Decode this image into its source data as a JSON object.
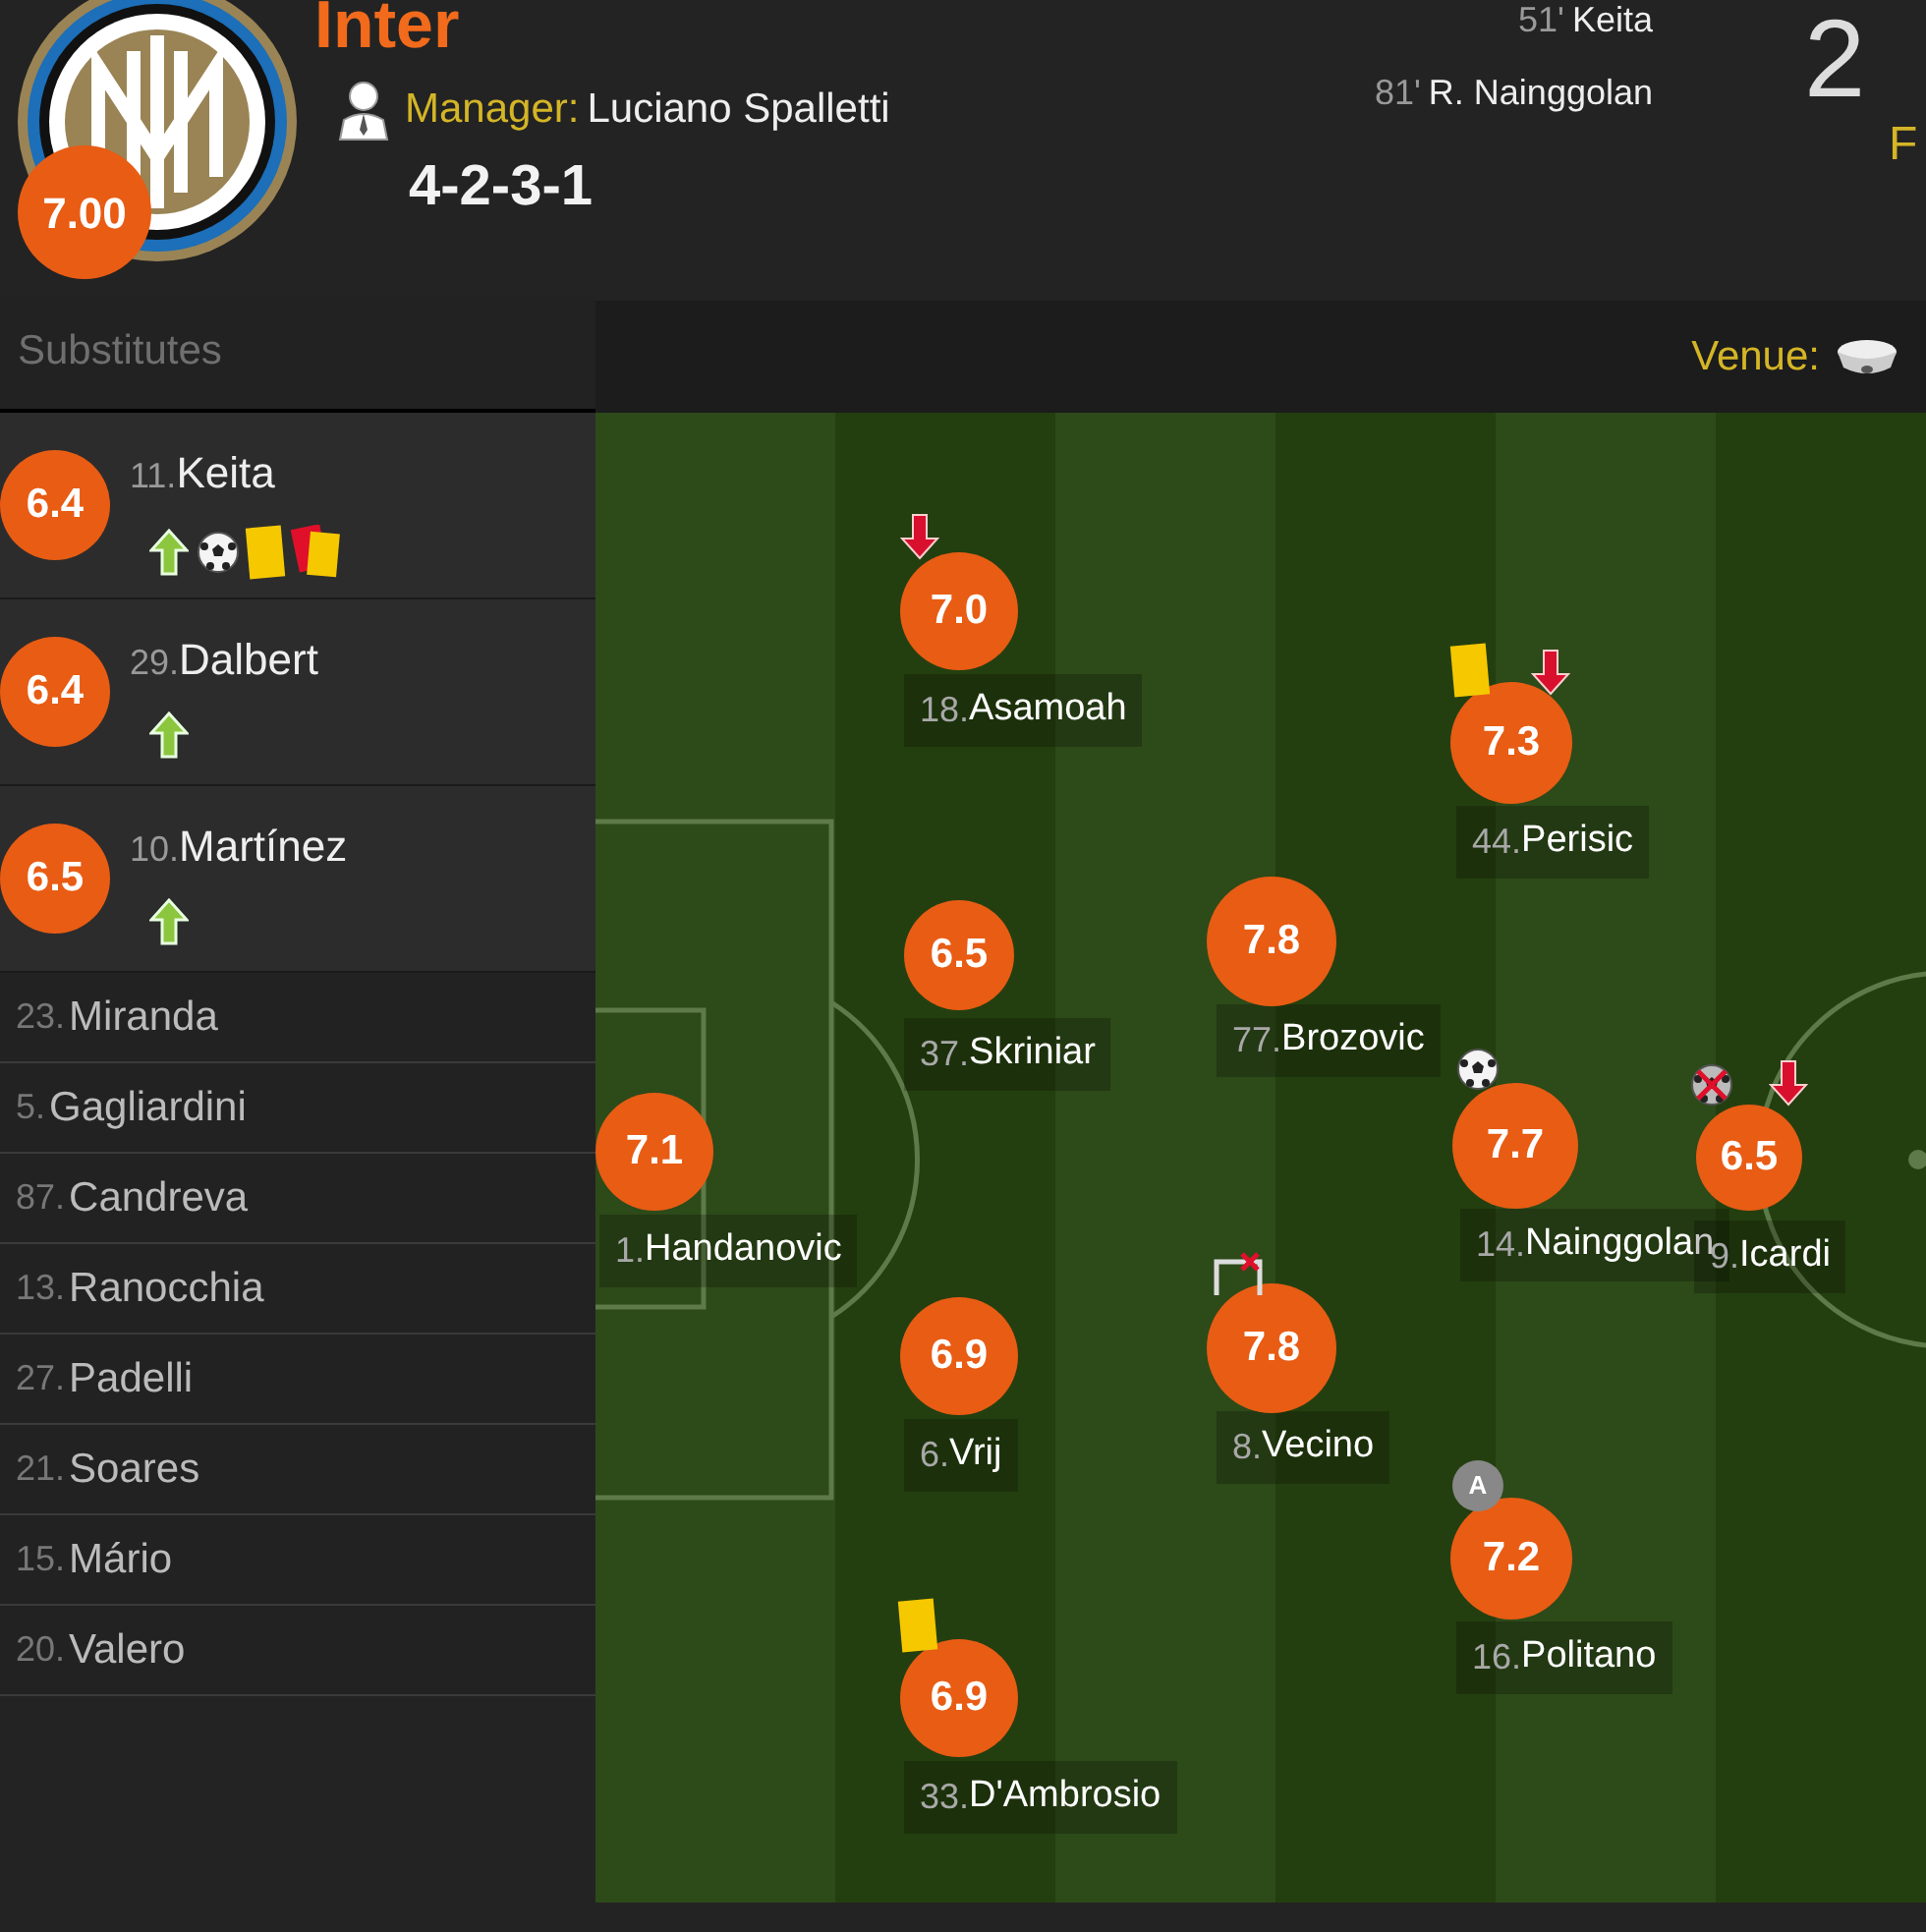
{
  "team": {
    "name": "Inter",
    "rating": "7.00",
    "manager_label": "Manager:",
    "manager": "Luciano Spalletti",
    "formation": "4-2-3-1"
  },
  "goals": [
    {
      "minute": "51'",
      "player": "Keita"
    },
    {
      "minute": "81'",
      "player": "R. Nainggolan"
    }
  ],
  "score": "2",
  "score_note": "F",
  "substitutes": {
    "title": "Substitutes",
    "used": [
      {
        "number": "11.",
        "name": "Keita",
        "rating": "6.4",
        "events": [
          {
            "kind": "sub_in"
          },
          {
            "kind": "goal"
          },
          {
            "kind": "yellow"
          },
          {
            "kind": "second_yellow"
          }
        ]
      },
      {
        "number": "29.",
        "name": "Dalbert",
        "rating": "6.4",
        "events": [
          {
            "kind": "sub_in"
          }
        ]
      },
      {
        "number": "10.",
        "name": "Martínez",
        "rating": "6.5",
        "events": [
          {
            "kind": "sub_in"
          }
        ]
      }
    ],
    "unused": [
      {
        "number": "23.",
        "name": "Miranda"
      },
      {
        "number": "5.",
        "name": "Gagliardini"
      },
      {
        "number": "87.",
        "name": "Candreva"
      },
      {
        "number": "13.",
        "name": "Ranocchia"
      },
      {
        "number": "27.",
        "name": "Padelli"
      },
      {
        "number": "21.",
        "name": "Soares"
      },
      {
        "number": "15.",
        "name": "Mário"
      },
      {
        "number": "20.",
        "name": "Valero"
      }
    ]
  },
  "pitch": {
    "venue_label": "Venue:",
    "players": [
      {
        "number": "18.",
        "name": "Asamoah",
        "rating": "7.0",
        "events": [
          {
            "kind": "sub_out"
          }
        ]
      },
      {
        "number": "44.",
        "name": "Perisic",
        "rating": "7.3",
        "events": [
          {
            "kind": "yellow"
          },
          {
            "kind": "sub_out"
          }
        ]
      },
      {
        "number": "37.",
        "name": "Skriniar",
        "rating": "6.5"
      },
      {
        "number": "77.",
        "name": "Brozovic",
        "rating": "7.8"
      },
      {
        "number": "1.",
        "name": "Handanovic",
        "rating": "7.1"
      },
      {
        "number": "14.",
        "name": "Nainggolan",
        "rating": "7.7",
        "events": [
          {
            "kind": "goal"
          }
        ]
      },
      {
        "number": "9.",
        "name": "Icardi",
        "rating": "6.5",
        "events": [
          {
            "kind": "missed_shot"
          },
          {
            "kind": "sub_out"
          }
        ]
      },
      {
        "number": "6.",
        "name": "Vrij",
        "rating": "6.9"
      },
      {
        "number": "8.",
        "name": "Vecino",
        "rating": "7.8",
        "events": [
          {
            "kind": "woodwork"
          }
        ]
      },
      {
        "number": "16.",
        "name": "Politano",
        "rating": "7.2",
        "events": [
          {
            "kind": "captain",
            "label": "A"
          }
        ]
      },
      {
        "number": "33.",
        "name": "D'Ambrosio",
        "rating": "6.9",
        "events": [
          {
            "kind": "yellow"
          }
        ]
      }
    ]
  }
}
